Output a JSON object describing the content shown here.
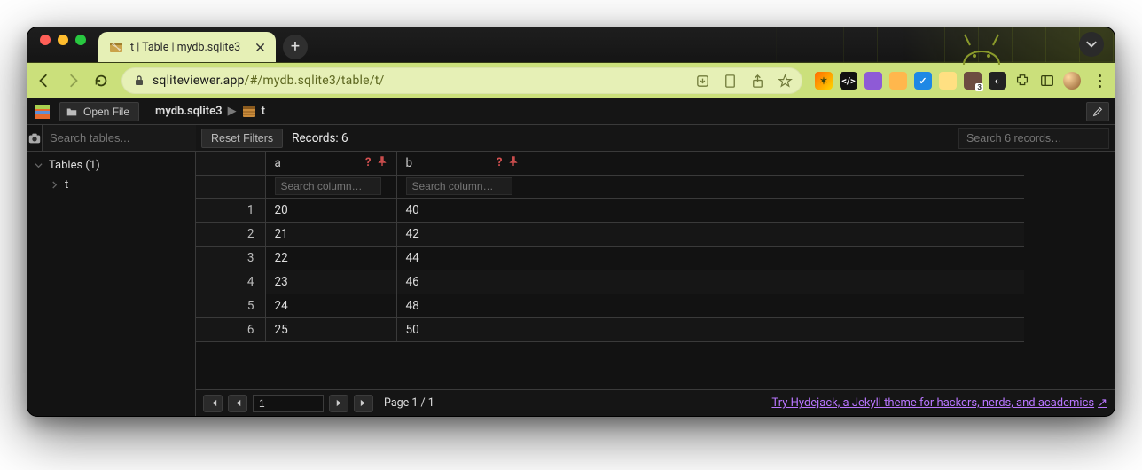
{
  "browser": {
    "tab_title": "t | Table | mydb.sqlite3",
    "url_host": "sqliteviewer.app",
    "url_path": "/#/mydb.sqlite3/table/t/"
  },
  "toolbar": {
    "open_file": "Open File"
  },
  "breadcrumb": {
    "db": "mydb.sqlite3",
    "table": "t"
  },
  "sidebar": {
    "search_placeholder": "Search tables...",
    "tables_label": "Tables (1)",
    "items": [
      {
        "name": "t"
      }
    ]
  },
  "content": {
    "reset_filters": "Reset Filters",
    "records_label": "Records: 6",
    "records_search_placeholder": "Search 6 records…",
    "col_search_placeholder": "Search column…",
    "columns": [
      {
        "name": "a"
      },
      {
        "name": "b"
      }
    ],
    "rows": [
      {
        "i": "1",
        "a": "20",
        "b": "40"
      },
      {
        "i": "2",
        "a": "21",
        "b": "42"
      },
      {
        "i": "3",
        "a": "22",
        "b": "44"
      },
      {
        "i": "4",
        "a": "23",
        "b": "46"
      },
      {
        "i": "5",
        "a": "24",
        "b": "48"
      },
      {
        "i": "6",
        "a": "25",
        "b": "50"
      }
    ]
  },
  "footer": {
    "page_input": "1",
    "page_label": "Page 1 / 1",
    "promo": "Try Hydejack, a Jekyll theme for hackers, nerds, and academics"
  }
}
